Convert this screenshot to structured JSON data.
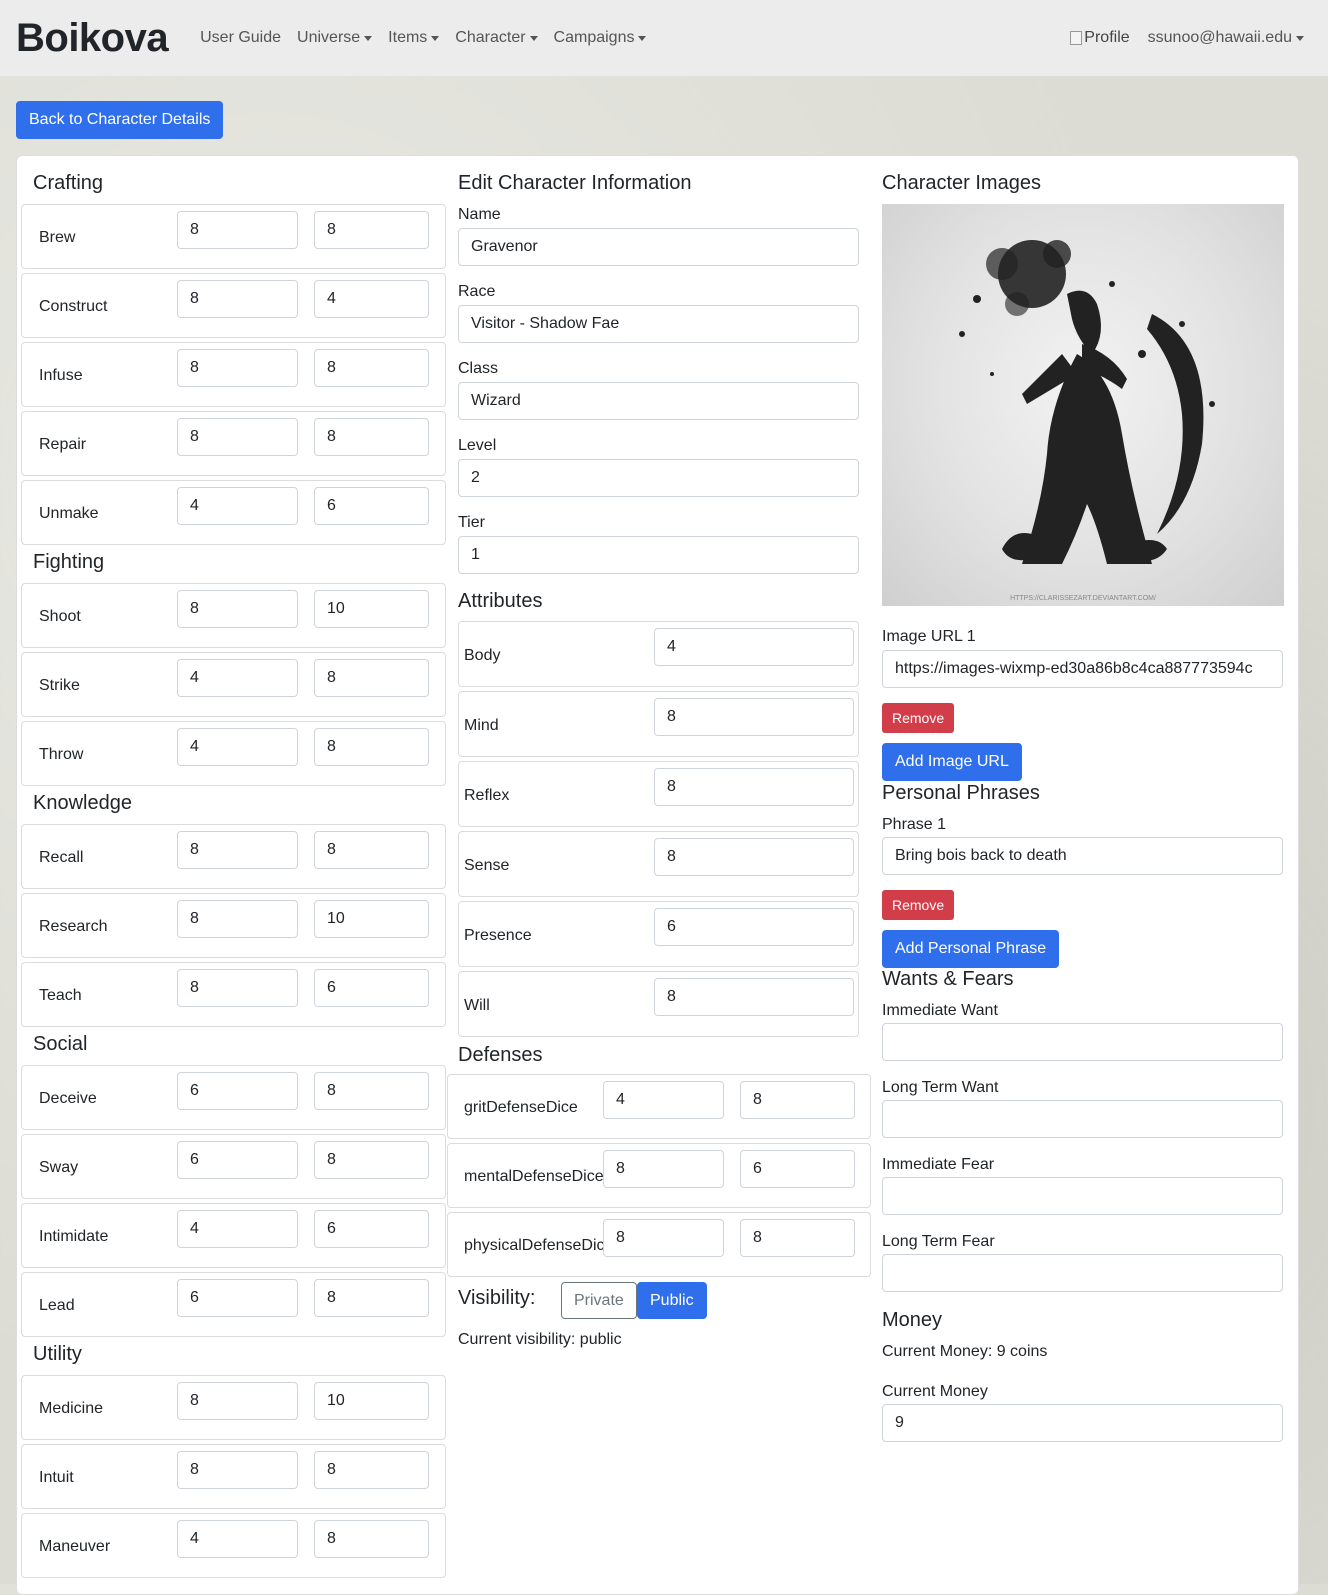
{
  "nav": {
    "brand": "Boikova",
    "items": [
      {
        "label": "User Guide",
        "dropdown": false
      },
      {
        "label": "Universe",
        "dropdown": true
      },
      {
        "label": "Items",
        "dropdown": true
      },
      {
        "label": "Character",
        "dropdown": true
      },
      {
        "label": "Campaigns",
        "dropdown": true
      }
    ],
    "profile_alt": "Profile",
    "user_email": "ssunoo@hawaii.edu"
  },
  "back_button": "Back to Character Details",
  "skills": {
    "groups": [
      {
        "title": "Crafting",
        "rows": [
          {
            "label": "Brew",
            "a": "8",
            "b": "8"
          },
          {
            "label": "Construct",
            "a": "8",
            "b": "4"
          },
          {
            "label": "Infuse",
            "a": "8",
            "b": "8"
          },
          {
            "label": "Repair",
            "a": "8",
            "b": "8"
          },
          {
            "label": "Unmake",
            "a": "4",
            "b": "6"
          }
        ]
      },
      {
        "title": "Fighting",
        "rows": [
          {
            "label": "Shoot",
            "a": "8",
            "b": "10"
          },
          {
            "label": "Strike",
            "a": "4",
            "b": "8"
          },
          {
            "label": "Throw",
            "a": "4",
            "b": "8"
          }
        ]
      },
      {
        "title": "Knowledge",
        "rows": [
          {
            "label": "Recall",
            "a": "8",
            "b": "8"
          },
          {
            "label": "Research",
            "a": "8",
            "b": "10"
          },
          {
            "label": "Teach",
            "a": "8",
            "b": "6"
          }
        ]
      },
      {
        "title": "Social",
        "rows": [
          {
            "label": "Deceive",
            "a": "6",
            "b": "8"
          },
          {
            "label": "Sway",
            "a": "6",
            "b": "8"
          },
          {
            "label": "Intimidate",
            "a": "4",
            "b": "6"
          },
          {
            "label": "Lead",
            "a": "6",
            "b": "8"
          }
        ]
      },
      {
        "title": "Utility",
        "rows": [
          {
            "label": "Medicine",
            "a": "8",
            "b": "10"
          },
          {
            "label": "Intuit",
            "a": "8",
            "b": "8"
          },
          {
            "label": "Maneuver",
            "a": "4",
            "b": "8"
          }
        ]
      }
    ]
  },
  "info": {
    "title": "Edit Character Information",
    "fields": [
      {
        "label": "Name",
        "value": "Gravenor"
      },
      {
        "label": "Race",
        "value": "Visitor - Shadow Fae"
      },
      {
        "label": "Class",
        "value": "Wizard"
      },
      {
        "label": "Level",
        "value": "2"
      },
      {
        "label": "Tier",
        "value": "1"
      }
    ]
  },
  "attributes": {
    "title": "Attributes",
    "rows": [
      {
        "label": "Body",
        "value": "4"
      },
      {
        "label": "Mind",
        "value": "8"
      },
      {
        "label": "Reflex",
        "value": "8"
      },
      {
        "label": "Sense",
        "value": "8"
      },
      {
        "label": "Presence",
        "value": "6"
      },
      {
        "label": "Will",
        "value": "8"
      }
    ]
  },
  "defenses": {
    "title": "Defenses",
    "rows": [
      {
        "label": "gritDefenseDice",
        "a": "4",
        "b": "8"
      },
      {
        "label": "mentalDefenseDice",
        "a": "8",
        "b": "6"
      },
      {
        "label": "physicalDefenseDic",
        "a": "8",
        "b": "8"
      }
    ]
  },
  "visibility": {
    "label": "Visibility:",
    "private_label": "Private",
    "public_label": "Public",
    "current": "Current visibility: public"
  },
  "images": {
    "title": "Character Images",
    "watermark": "HTTPS://CLARISSEZART.DEVIANTART.COM/",
    "url_label": "Image URL 1",
    "url_value": "https://images-wixmp-ed30a86b8c4ca887773594c",
    "remove_label": "Remove",
    "add_label": "Add Image URL"
  },
  "phrases": {
    "title": "Personal Phrases",
    "phrase_label": "Phrase 1",
    "phrase_value": "Bring bois back to death",
    "remove_label": "Remove",
    "add_label": "Add Personal Phrase"
  },
  "wants_fears": {
    "title": "Wants & Fears",
    "fields": [
      {
        "label": "Immediate Want",
        "value": ""
      },
      {
        "label": "Long Term Want",
        "value": ""
      },
      {
        "label": "Immediate Fear",
        "value": ""
      },
      {
        "label": "Long Term Fear",
        "value": ""
      }
    ]
  },
  "money": {
    "title": "Money",
    "current_text": "Current Money: 9 coins",
    "field_label": "Current Money",
    "field_value": "9"
  },
  "colors": {
    "primary": "#2f6fec",
    "danger": "#d13d48",
    "navbar": "#ececec"
  }
}
